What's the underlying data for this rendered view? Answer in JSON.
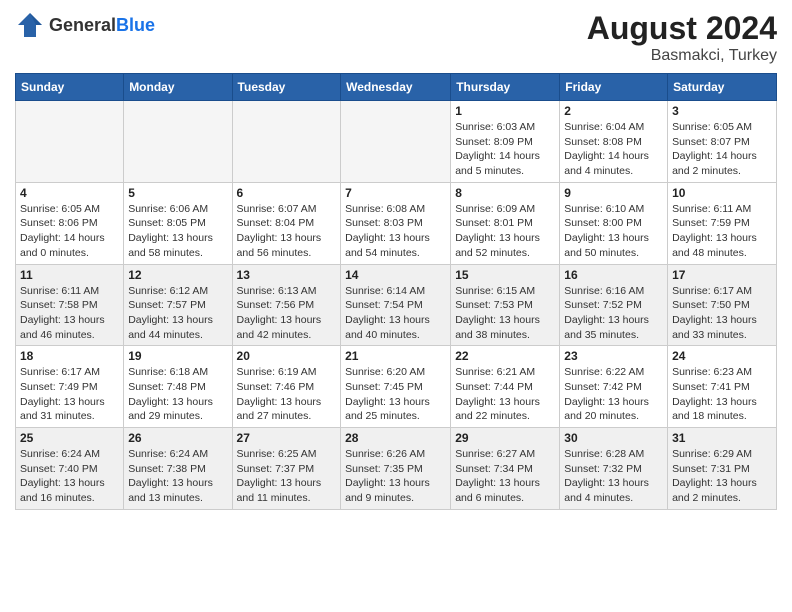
{
  "header": {
    "logo_general": "General",
    "logo_blue": "Blue",
    "month_year": "August 2024",
    "location": "Basmakci, Turkey"
  },
  "weekdays": [
    "Sunday",
    "Monday",
    "Tuesday",
    "Wednesday",
    "Thursday",
    "Friday",
    "Saturday"
  ],
  "weeks": [
    [
      {
        "day": "",
        "empty": true
      },
      {
        "day": "",
        "empty": true
      },
      {
        "day": "",
        "empty": true
      },
      {
        "day": "",
        "empty": true
      },
      {
        "day": "1",
        "sunrise": "6:03 AM",
        "sunset": "8:09 PM",
        "daylight": "14 hours and 5 minutes."
      },
      {
        "day": "2",
        "sunrise": "6:04 AM",
        "sunset": "8:08 PM",
        "daylight": "14 hours and 4 minutes."
      },
      {
        "day": "3",
        "sunrise": "6:05 AM",
        "sunset": "8:07 PM",
        "daylight": "14 hours and 2 minutes."
      }
    ],
    [
      {
        "day": "4",
        "sunrise": "6:05 AM",
        "sunset": "8:06 PM",
        "daylight": "14 hours and 0 minutes."
      },
      {
        "day": "5",
        "sunrise": "6:06 AM",
        "sunset": "8:05 PM",
        "daylight": "13 hours and 58 minutes."
      },
      {
        "day": "6",
        "sunrise": "6:07 AM",
        "sunset": "8:04 PM",
        "daylight": "13 hours and 56 minutes."
      },
      {
        "day": "7",
        "sunrise": "6:08 AM",
        "sunset": "8:03 PM",
        "daylight": "13 hours and 54 minutes."
      },
      {
        "day": "8",
        "sunrise": "6:09 AM",
        "sunset": "8:01 PM",
        "daylight": "13 hours and 52 minutes."
      },
      {
        "day": "9",
        "sunrise": "6:10 AM",
        "sunset": "8:00 PM",
        "daylight": "13 hours and 50 minutes."
      },
      {
        "day": "10",
        "sunrise": "6:11 AM",
        "sunset": "7:59 PM",
        "daylight": "13 hours and 48 minutes."
      }
    ],
    [
      {
        "day": "11",
        "sunrise": "6:11 AM",
        "sunset": "7:58 PM",
        "daylight": "13 hours and 46 minutes."
      },
      {
        "day": "12",
        "sunrise": "6:12 AM",
        "sunset": "7:57 PM",
        "daylight": "13 hours and 44 minutes."
      },
      {
        "day": "13",
        "sunrise": "6:13 AM",
        "sunset": "7:56 PM",
        "daylight": "13 hours and 42 minutes."
      },
      {
        "day": "14",
        "sunrise": "6:14 AM",
        "sunset": "7:54 PM",
        "daylight": "13 hours and 40 minutes."
      },
      {
        "day": "15",
        "sunrise": "6:15 AM",
        "sunset": "7:53 PM",
        "daylight": "13 hours and 38 minutes."
      },
      {
        "day": "16",
        "sunrise": "6:16 AM",
        "sunset": "7:52 PM",
        "daylight": "13 hours and 35 minutes."
      },
      {
        "day": "17",
        "sunrise": "6:17 AM",
        "sunset": "7:50 PM",
        "daylight": "13 hours and 33 minutes."
      }
    ],
    [
      {
        "day": "18",
        "sunrise": "6:17 AM",
        "sunset": "7:49 PM",
        "daylight": "13 hours and 31 minutes."
      },
      {
        "day": "19",
        "sunrise": "6:18 AM",
        "sunset": "7:48 PM",
        "daylight": "13 hours and 29 minutes."
      },
      {
        "day": "20",
        "sunrise": "6:19 AM",
        "sunset": "7:46 PM",
        "daylight": "13 hours and 27 minutes."
      },
      {
        "day": "21",
        "sunrise": "6:20 AM",
        "sunset": "7:45 PM",
        "daylight": "13 hours and 25 minutes."
      },
      {
        "day": "22",
        "sunrise": "6:21 AM",
        "sunset": "7:44 PM",
        "daylight": "13 hours and 22 minutes."
      },
      {
        "day": "23",
        "sunrise": "6:22 AM",
        "sunset": "7:42 PM",
        "daylight": "13 hours and 20 minutes."
      },
      {
        "day": "24",
        "sunrise": "6:23 AM",
        "sunset": "7:41 PM",
        "daylight": "13 hours and 18 minutes."
      }
    ],
    [
      {
        "day": "25",
        "sunrise": "6:24 AM",
        "sunset": "7:40 PM",
        "daylight": "13 hours and 16 minutes."
      },
      {
        "day": "26",
        "sunrise": "6:24 AM",
        "sunset": "7:38 PM",
        "daylight": "13 hours and 13 minutes."
      },
      {
        "day": "27",
        "sunrise": "6:25 AM",
        "sunset": "7:37 PM",
        "daylight": "13 hours and 11 minutes."
      },
      {
        "day": "28",
        "sunrise": "6:26 AM",
        "sunset": "7:35 PM",
        "daylight": "13 hours and 9 minutes."
      },
      {
        "day": "29",
        "sunrise": "6:27 AM",
        "sunset": "7:34 PM",
        "daylight": "13 hours and 6 minutes."
      },
      {
        "day": "30",
        "sunrise": "6:28 AM",
        "sunset": "7:32 PM",
        "daylight": "13 hours and 4 minutes."
      },
      {
        "day": "31",
        "sunrise": "6:29 AM",
        "sunset": "7:31 PM",
        "daylight": "13 hours and 2 minutes."
      }
    ]
  ]
}
